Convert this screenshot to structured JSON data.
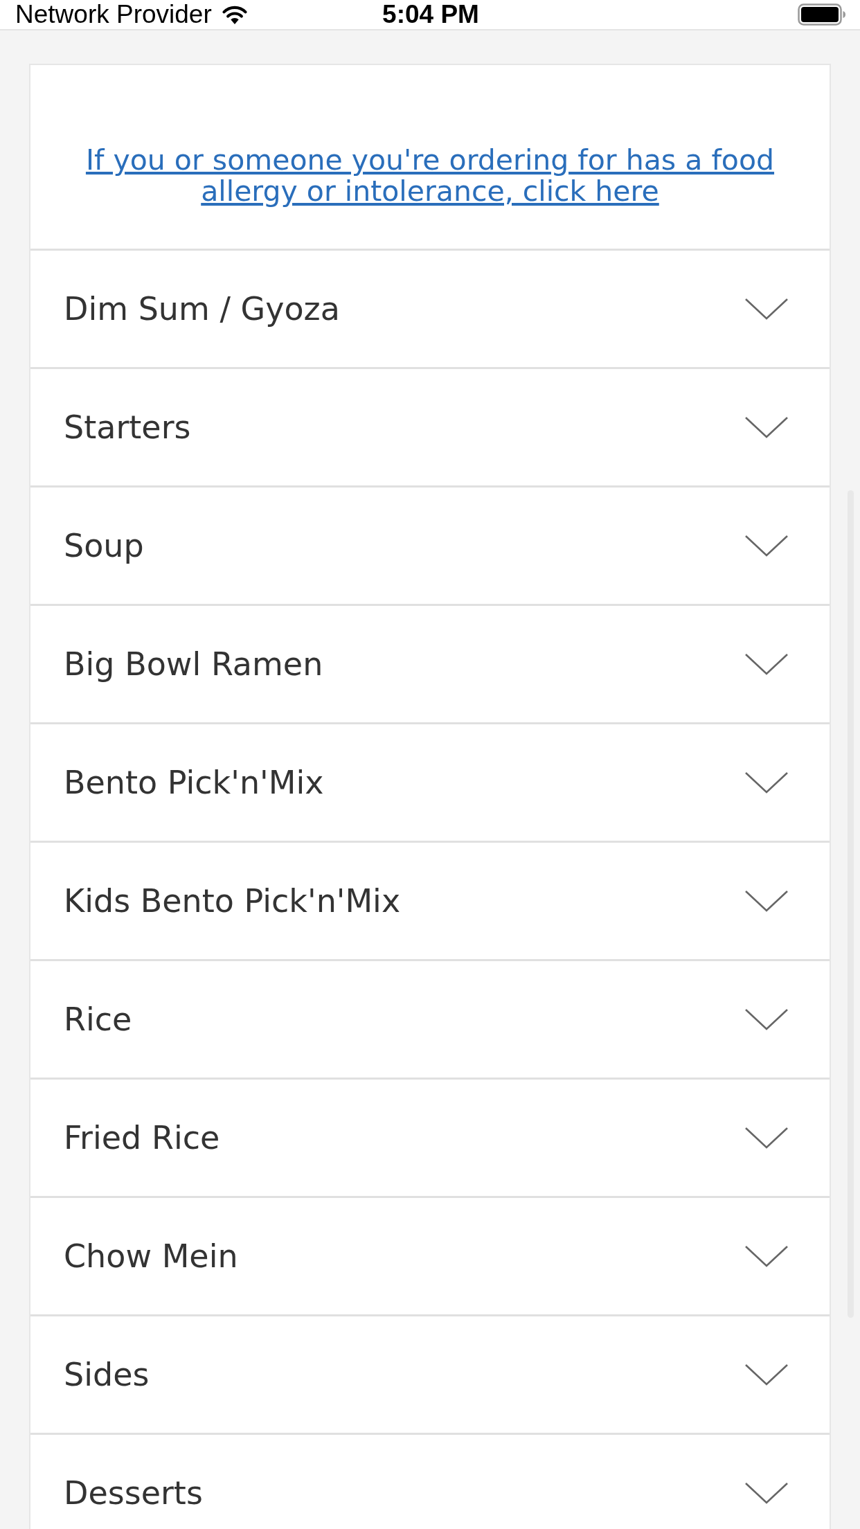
{
  "status_bar": {
    "carrier": "Network Provider",
    "time": "5:04 PM"
  },
  "allergy_link": {
    "text": "If you or someone you're ordering for has a food allergy or intolerance, click here"
  },
  "categories": [
    {
      "label": "Dim Sum / Gyoza",
      "expanded": false
    },
    {
      "label": "Starters",
      "expanded": false
    },
    {
      "label": "Soup",
      "expanded": false
    },
    {
      "label": "Big Bowl Ramen",
      "expanded": false
    },
    {
      "label": "Bento Pick'n'Mix",
      "expanded": false
    },
    {
      "label": "Kids Bento Pick'n'Mix",
      "expanded": false
    },
    {
      "label": "Rice",
      "expanded": false
    },
    {
      "label": "Fried Rice",
      "expanded": false
    },
    {
      "label": "Chow Mein",
      "expanded": false
    },
    {
      "label": "Sides",
      "expanded": false
    },
    {
      "label": "Desserts",
      "expanded": false
    }
  ]
}
